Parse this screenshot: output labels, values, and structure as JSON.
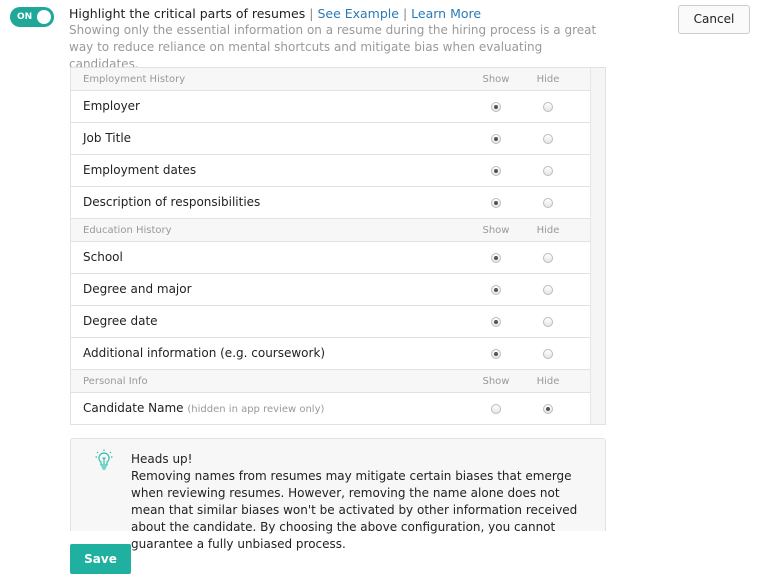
{
  "toggle": {
    "label": "ON",
    "state": true
  },
  "header": {
    "title": "Highlight the critical parts of resumes",
    "sep": "|",
    "see_example": "See Example",
    "learn_more": "Learn More",
    "description": "Showing only the essential information on a resume during the hiring process is a great way to reduce reliance on mental shortcuts and mitigate bias when evaluating candidates."
  },
  "cancel_label": "Cancel",
  "sections": [
    {
      "title": "Employment History",
      "show": "Show",
      "hide": "Hide",
      "rows": [
        {
          "label": "Employer",
          "note": "",
          "value": "show"
        },
        {
          "label": "Job Title",
          "note": "",
          "value": "show"
        },
        {
          "label": "Employment dates",
          "note": "",
          "value": "show"
        },
        {
          "label": "Description of responsibilities",
          "note": "",
          "value": "show"
        }
      ]
    },
    {
      "title": "Education History",
      "show": "Show",
      "hide": "Hide",
      "rows": [
        {
          "label": "School",
          "note": "",
          "value": "show"
        },
        {
          "label": "Degree and major",
          "note": "",
          "value": "show"
        },
        {
          "label": "Degree date",
          "note": "",
          "value": "show"
        },
        {
          "label": "Additional information (e.g. coursework)",
          "note": "",
          "value": "show"
        }
      ]
    },
    {
      "title": "Personal Info",
      "show": "Show",
      "hide": "Hide",
      "rows": [
        {
          "label": "Candidate Name",
          "note": "(hidden in app review only)",
          "value": "hide"
        }
      ]
    }
  ],
  "notice": {
    "icon": "lightbulb-icon",
    "title": "Heads up!",
    "text": "Removing names from resumes may mitigate certain biases that emerge when reviewing resumes. However, removing the name alone does not mean that similar biases won't be activated by other information received about the candidate. By choosing the above configuration, you cannot guarantee a fully unbiased process."
  },
  "save_label": "Save",
  "colors": {
    "accent": "#1fb09f",
    "link": "#2a7ab8"
  }
}
